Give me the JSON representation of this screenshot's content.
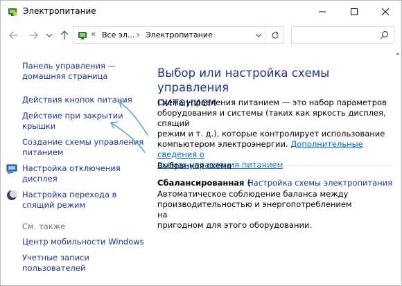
{
  "window": {
    "title": "Электропитание",
    "icon": "power-options-icon"
  },
  "caption": {
    "minimize": "minimize-icon",
    "maximize": "maximize-icon",
    "close": "close-icon"
  },
  "nav": {
    "back": "back-arrow-icon",
    "forward": "forward-arrow-icon",
    "recent": "chevron-down-icon",
    "up": "up-arrow-icon"
  },
  "address": {
    "chevron": "«",
    "segments": [
      "Все эл...",
      "Электропитание"
    ],
    "separator": "›",
    "refresh": "refresh-icon"
  },
  "search": {
    "placeholder": ""
  },
  "left_pane": {
    "home_link_line1": "Панель управления —",
    "home_link_line2": "домашняя страница",
    "links": [
      {
        "line1": "Действия кнопок питания",
        "line2": ""
      },
      {
        "line1": "Действие при закрытии",
        "line2": "крышки"
      },
      {
        "line1": "Создание схемы управления",
        "line2": "питанием"
      },
      {
        "line1": "Настройка отключения",
        "line2": "дисплея",
        "icon": "display-icon"
      },
      {
        "line1": "Настройка перехода в",
        "line2": "спящий режим",
        "icon": "moon-icon"
      }
    ],
    "see_also": "См. также",
    "see_also_links": [
      {
        "line1": "Центр мобильности Windows",
        "line2": ""
      },
      {
        "line1": "Учетные записи",
        "line2": "пользователей"
      }
    ]
  },
  "main": {
    "heading_line1": "Выбор или настройка схемы управления",
    "heading_line2": "питанием",
    "description_line1": "Схема управления питанием — это набор параметров",
    "description_line2": "оборудования и системы (таких как яркость дисплея, спящий",
    "description_line3": "режим и т. д.), которые контролирует использование",
    "description_line4": "компьютером электроэнергии.",
    "description_link_part1": "Дополнительные сведения о",
    "description_link_part2": "схемах управления питанием",
    "selected_label": "Выбранная схема",
    "plan_name": "Сбалансированная (",
    "plan_settings_link": "Настройка схемы электропитания",
    "plan_desc_line1": "Автоматическое соблюдение баланса между",
    "plan_desc_line2": "производительностью и энергопотреблением на",
    "plan_desc_line3": "пригодном для этого оборудовании."
  },
  "colors": {
    "link": "#1e3287",
    "hyperlink": "#0066cc",
    "annotation": "#5aa6d6",
    "muted": "#6d6d6d"
  }
}
